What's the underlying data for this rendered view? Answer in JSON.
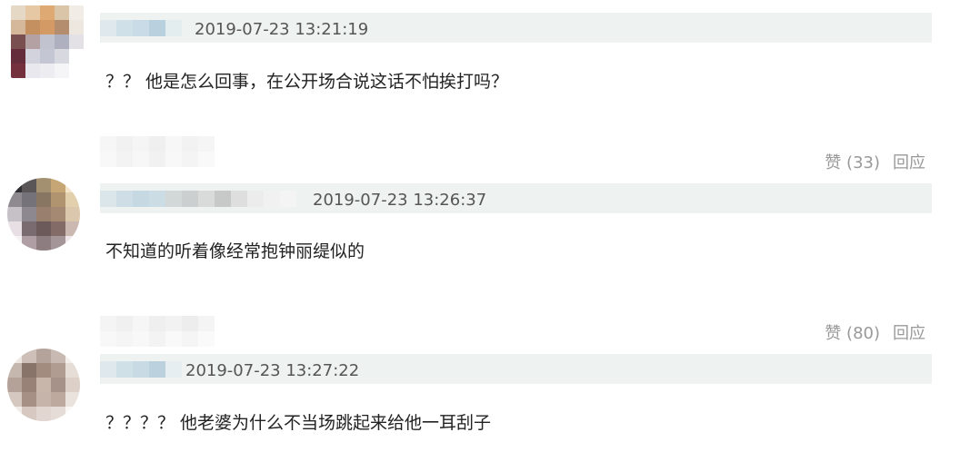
{
  "comments": [
    {
      "timestamp": "2019-07-23 13:21:19",
      "text": "？？ 他是怎么回事，在公开场合说这话不怕挨打吗？",
      "likes_label": "赞 (33)",
      "reply_label": "回应"
    },
    {
      "timestamp": "2019-07-23 13:26:37",
      "text": "不知道的听着像经常抱钟丽缇似的",
      "likes_label": "赞 (80)",
      "reply_label": "回应"
    },
    {
      "timestamp": "2019-07-23 13:27:22",
      "text": "？？？？ 他老婆为什么不当场跳起来给他一耳刮子"
    }
  ],
  "colors": {
    "meta_bg": "#eef2f1",
    "action_text": "#999999",
    "text": "#222222"
  }
}
